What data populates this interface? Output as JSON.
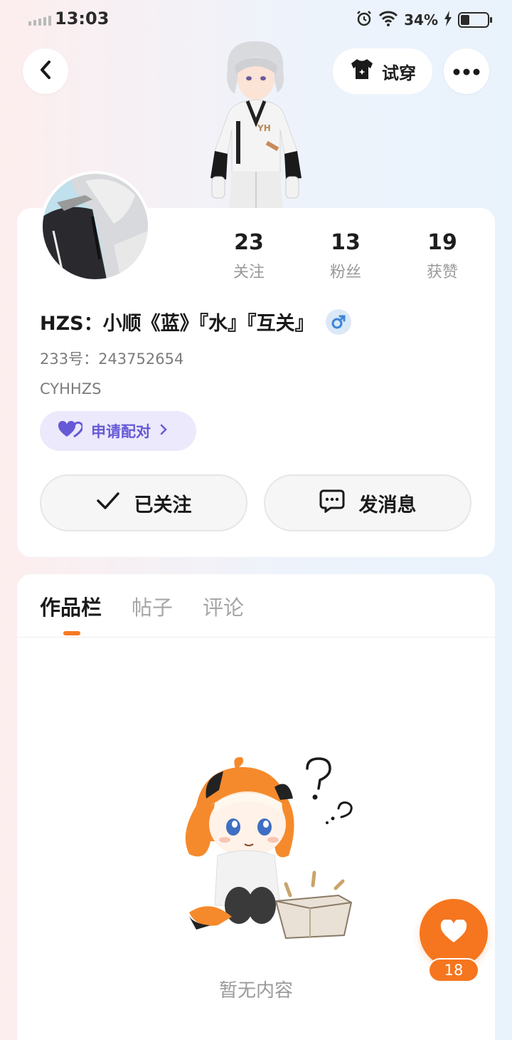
{
  "status_bar": {
    "time": "13:03",
    "battery_percent": "34%",
    "battery_level": 0.34
  },
  "nav": {
    "tryon_label": "试穿"
  },
  "profile": {
    "stats": [
      {
        "value": "23",
        "label": "关注"
      },
      {
        "value": "13",
        "label": "粉丝"
      },
      {
        "value": "19",
        "label": "获赞"
      }
    ],
    "name": "HZS：小顺《蓝》『水』『互关』",
    "gender": "male",
    "uid_text": "233号：243752654",
    "signature": "CYHHZS",
    "pair_label": "申请配对",
    "follow_label": "已关注",
    "message_label": "发消息"
  },
  "content": {
    "tabs": [
      {
        "label": "作品栏",
        "active": true
      },
      {
        "label": "帖子",
        "active": false
      },
      {
        "label": "评论",
        "active": false
      }
    ],
    "empty_text": "暂无内容"
  },
  "like_fab": {
    "count": "18"
  },
  "colors": {
    "accent_orange": "#f5761e",
    "pair_purple": "#6659d6",
    "gender_blue": "#3b86d8"
  }
}
